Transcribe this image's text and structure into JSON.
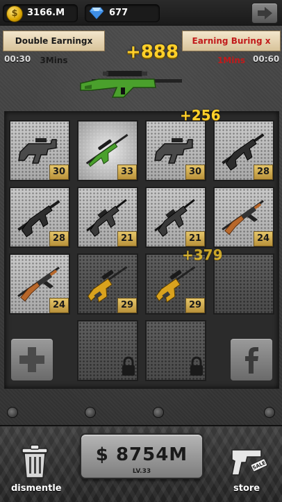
{
  "currency": {
    "coins": "3166.M",
    "gems": "677"
  },
  "banners": {
    "left": "Double Earningx 3Mins",
    "right": "Earning Buring x 1Mins",
    "left_timer": "00:30",
    "right_timer": "00:60"
  },
  "floating": {
    "big": "+888",
    "small_1": "+256",
    "small_2": "+379"
  },
  "grid": {
    "cells": [
      {
        "type": "smg",
        "level": "30"
      },
      {
        "type": "sniper_green",
        "level": "33"
      },
      {
        "type": "smg",
        "level": "30"
      },
      {
        "type": "rifle_dark",
        "level": "28"
      },
      {
        "type": "rifle_dark",
        "level": "28"
      },
      {
        "type": "m4",
        "level": "21"
      },
      {
        "type": "m4",
        "level": "21"
      },
      {
        "type": "ak",
        "level": "24"
      },
      {
        "type": "ak",
        "level": "24"
      },
      {
        "type": "sniper_gold",
        "level": "29"
      },
      {
        "type": "sniper_gold",
        "level": "29"
      },
      {
        "type": "empty",
        "level": ""
      },
      {
        "type": "empty",
        "level": ""
      },
      {
        "type": "locked",
        "level": ""
      },
      {
        "type": "locked",
        "level": ""
      },
      {
        "type": "empty",
        "level": ""
      }
    ]
  },
  "bottom": {
    "money": "$ 8754M",
    "level": "LV.33",
    "dismantle_label": "dismentle",
    "store_label": "store",
    "sale_tag": "SALE"
  },
  "icons": {
    "coin": "coin-icon",
    "gem": "diamond-icon",
    "next": "arrow-right-icon",
    "add": "plus-icon",
    "facebook": "facebook-icon",
    "trash": "trash-icon",
    "store": "gun-sale-icon",
    "lock": "lock-icon"
  },
  "colors": {
    "gold": "#ffd02a",
    "banner_red": "#c11a1a",
    "banner_bg": "#e8d7b3"
  }
}
